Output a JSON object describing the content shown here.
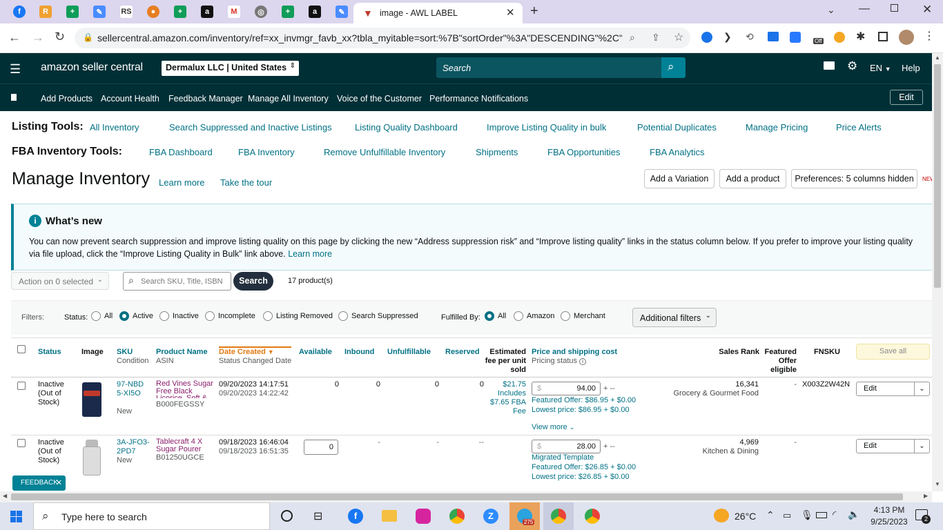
{
  "browser": {
    "active_tab_title": "image - AWL LABEL",
    "url": "sellercentral.amazon.com/inventory/ref=xx_invmgr_favb_xx?tbla_myitable=sort:%7B\"sortOrder\"%3A\"DESCENDING\"%2C\"s...",
    "off_badge": "Off"
  },
  "header": {
    "logo": "amazon seller central",
    "account": "Dermalux LLC | United States",
    "search_placeholder": "Search",
    "language": "EN",
    "help": "Help"
  },
  "nav": {
    "items": [
      "Add Products",
      "Account Health",
      "Feedback Manager",
      "Manage All Inventory",
      "Voice of the Customer",
      "Performance Notifications"
    ],
    "edit": "Edit"
  },
  "listing_tools": {
    "label": "Listing Tools:",
    "links": [
      "All Inventory",
      "Search Suppressed and Inactive Listings",
      "Listing Quality Dashboard",
      "Improve Listing Quality in bulk",
      "Potential Duplicates",
      "Manage Pricing",
      "Price Alerts"
    ]
  },
  "fba_tools": {
    "label": "FBA Inventory Tools:",
    "links": [
      "FBA Dashboard",
      "FBA Inventory",
      "Remove Unfulfillable Inventory",
      "Shipments",
      "FBA Opportunities",
      "FBA Analytics"
    ]
  },
  "page": {
    "title": "Manage Inventory",
    "learn_more": "Learn more",
    "take_tour": "Take the tour",
    "add_variation": "Add a Variation",
    "add_product": "Add a product",
    "preferences": "Preferences: 5 columns hidden",
    "new_badge": "NEW"
  },
  "whats_new": {
    "title": "What’s new",
    "body": "You can now prevent search suppression and improve listing quality on this page by clicking the new “Address suppression risk” and “Improve listing quality” links in the status column below. If you prefer to improve your listing quality via file upload, click the “Improve Listing Quality in Bulk” link above.",
    "learn_more": "Learn more"
  },
  "toolbar": {
    "action": "Action on 0 selected",
    "search_placeholder": "Search SKU, Title, ISBN",
    "search_btn": "Search",
    "count": "17 product(s)"
  },
  "filters": {
    "label": "Filters:",
    "status_label": "Status:",
    "status_options": [
      "All",
      "Active",
      "Inactive",
      "Incomplete",
      "Listing Removed",
      "Search Suppressed"
    ],
    "status_selected": "Active",
    "fulfilled_label": "Fulfilled By:",
    "fulfilled_options": [
      "All",
      "Amazon",
      "Merchant"
    ],
    "fulfilled_selected": "All",
    "additional": "Additional filters"
  },
  "table": {
    "headers": {
      "status": "Status",
      "image": "Image",
      "sku": "SKU",
      "sku_sub": "Condition",
      "name": "Product Name",
      "name_sub": "ASIN",
      "date": "Date Created",
      "date_sub": "Status Changed Date",
      "available": "Available",
      "inbound": "Inbound",
      "unfulfillable": "Unfulfillable",
      "reserved": "Reserved",
      "fee": "Estimated fee per unit sold",
      "price": "Price and shipping cost",
      "price_sub": "Pricing status",
      "rank": "Sales Rank",
      "featured": "Featured Offer eligible",
      "fnsku": "FNSKU",
      "save_all": "Save all"
    },
    "rows": [
      {
        "status": "Inactive (Out of Stock)",
        "sku": "97-NBD5-XI5O",
        "condition": "New",
        "name": "Red Vines Sugar Free Black Licorice, Soft & Chew...",
        "asin": "B000FEGSSY",
        "created": "09/20/2023 14:17:51",
        "changed": "09/20/2023 14:22:42",
        "available": "0",
        "inbound": "0",
        "unfulfillable": "0",
        "reserved": "0",
        "fee": "$21.75 Includes $7.65 FBA Fee",
        "price": "94.00",
        "price_suffix": "+ --",
        "pricing_status": "",
        "featured_offer": "Featured Offer: $86.95 + $0.00",
        "lowest": "Lowest price: $86.95 + $0.00",
        "view_more": "View more",
        "rank": "16,341",
        "rank_cat": "Grocery & Gourmet Food",
        "featured_elig": "-",
        "fnsku": "X003Z2W42N",
        "edit": "Edit"
      },
      {
        "status": "Inactive (Out of Stock)",
        "sku": "3A-JFO3-2PD7",
        "condition": "New",
        "name": "Tablecraft 4 X Sugar Pourer",
        "asin": "B01250UGCE",
        "created": "09/18/2023 16:46:04",
        "changed": "09/18/2023 16:51:35",
        "available": "0",
        "inbound": "-",
        "unfulfillable": "-",
        "reserved": "--",
        "fee": "",
        "price": "28.00",
        "price_suffix": "+ --",
        "pricing_status": "Migrated Template",
        "featured_offer": "Featured Offer: $26.85 + $0.00",
        "lowest": "Lowest price: $26.85 + $0.00",
        "view_more": "",
        "rank": "4,969",
        "rank_cat": "Kitchen & Dining",
        "featured_elig": "-",
        "fnsku": "",
        "edit": "Edit"
      }
    ]
  },
  "feedback": "FEEDBACK",
  "taskbar": {
    "search": "Type here to search",
    "temp": "26°C",
    "time": "4:13 PM",
    "date": "9/25/2023",
    "telegram_badge": "275",
    "notif": "2"
  }
}
